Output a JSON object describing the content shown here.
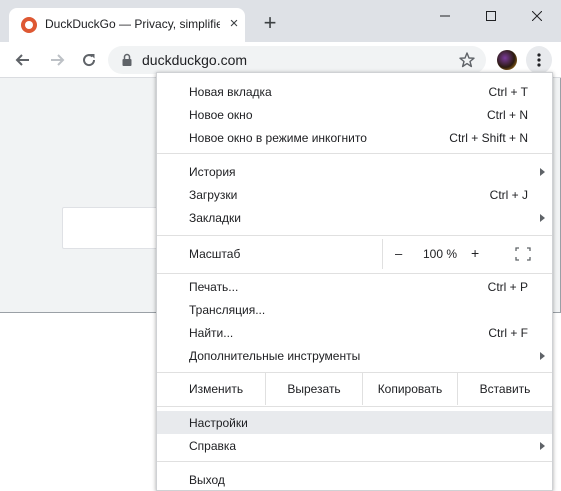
{
  "tab": {
    "title": "DuckDuckGo — Privacy, simplifie",
    "close": "×",
    "new_tab": "+"
  },
  "window_controls": {
    "minimize": "—",
    "maximize": "☐",
    "close": "✕"
  },
  "toolbar": {
    "url": "duckduckgo.com"
  },
  "icons": [
    "duckduckgo-favicon",
    "back-arrow-icon",
    "forward-arrow-icon",
    "reload-icon",
    "lock-icon",
    "star-icon",
    "avatar",
    "kebab-menu-icon",
    "fullscreen-icon",
    "submenu-arrow-icon"
  ],
  "colors": {
    "titlebar": "#dee1e6",
    "menu_highlight": "#e8eaed",
    "favicon": "#de5833"
  },
  "menu": {
    "new_tab": {
      "label": "Новая вкладка",
      "shortcut": "Ctrl + T"
    },
    "new_window": {
      "label": "Новое окно",
      "shortcut": "Ctrl + N"
    },
    "incognito": {
      "label": "Новое окно в режиме инкогнито",
      "shortcut": "Ctrl + Shift + N"
    },
    "history": {
      "label": "История"
    },
    "downloads": {
      "label": "Загрузки",
      "shortcut": "Ctrl + J"
    },
    "bookmarks": {
      "label": "Закладки"
    },
    "zoom": {
      "label": "Масштаб",
      "minus": "–",
      "value": "100 %",
      "plus": "+"
    },
    "print": {
      "label": "Печать...",
      "shortcut": "Ctrl + P"
    },
    "cast": {
      "label": "Трансляция..."
    },
    "find": {
      "label": "Найти...",
      "shortcut": "Ctrl + F"
    },
    "more_tools": {
      "label": "Дополнительные инструменты"
    },
    "edit": {
      "label": "Изменить",
      "cut": "Вырезать",
      "copy": "Копировать",
      "paste": "Вставить"
    },
    "settings": {
      "label": "Настройки"
    },
    "help": {
      "label": "Справка"
    },
    "exit": {
      "label": "Выход"
    }
  }
}
